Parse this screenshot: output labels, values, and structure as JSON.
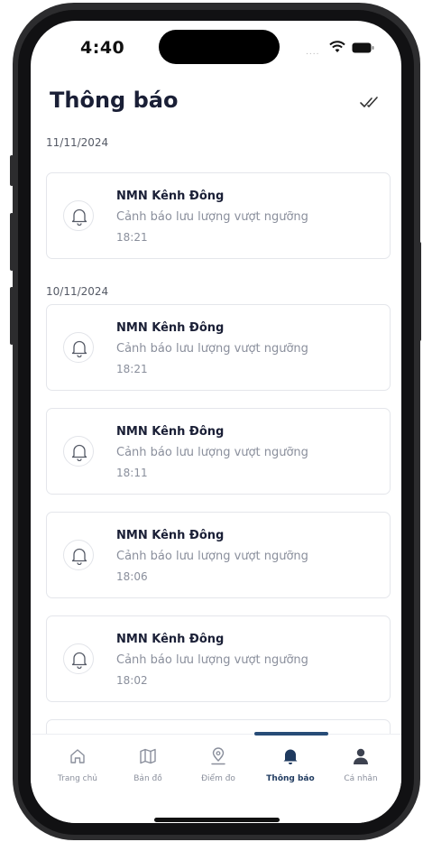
{
  "status_bar": {
    "time": "4:40",
    "signal_dots": "....",
    "wifi_icon": "wifi-icon",
    "battery_icon": "battery-icon"
  },
  "header": {
    "title": "Thông báo",
    "mark_all_icon": "double-check-icon"
  },
  "groups": [
    {
      "date": "11/11/2024",
      "items": [
        {
          "title": "NMN Kênh Đông",
          "message": "Cảnh báo lưu lượng vượt ngưỡng",
          "time": "18:21"
        }
      ]
    },
    {
      "date": "10/11/2024",
      "items": [
        {
          "title": "NMN Kênh Đông",
          "message": "Cảnh báo lưu lượng vượt ngưỡng",
          "time": "18:21"
        },
        {
          "title": "NMN Kênh Đông",
          "message": "Cảnh báo lưu lượng vượt ngưỡng",
          "time": "18:11"
        },
        {
          "title": "NMN Kênh Đông",
          "message": "Cảnh báo lưu lượng vượt ngưỡng",
          "time": "18:06"
        },
        {
          "title": "NMN Kênh Đông",
          "message": "Cảnh báo lưu lượng vượt ngưỡng",
          "time": "18:02"
        }
      ]
    }
  ],
  "tab_bar": {
    "active": "Thông báo",
    "tabs": [
      {
        "label": "Trang chủ",
        "icon": "home-icon"
      },
      {
        "label": "Bản đồ",
        "icon": "map-icon"
      },
      {
        "label": "Điểm đo",
        "icon": "location-pin-icon"
      },
      {
        "label": "Thông báo",
        "icon": "bell-icon"
      },
      {
        "label": "Cá nhân",
        "icon": "person-icon"
      }
    ]
  },
  "colors": {
    "primary": "#1f3a5f",
    "text_dark": "#1a1f36",
    "text_muted": "#8a8f9c",
    "card_border": "#e4e6eb"
  }
}
